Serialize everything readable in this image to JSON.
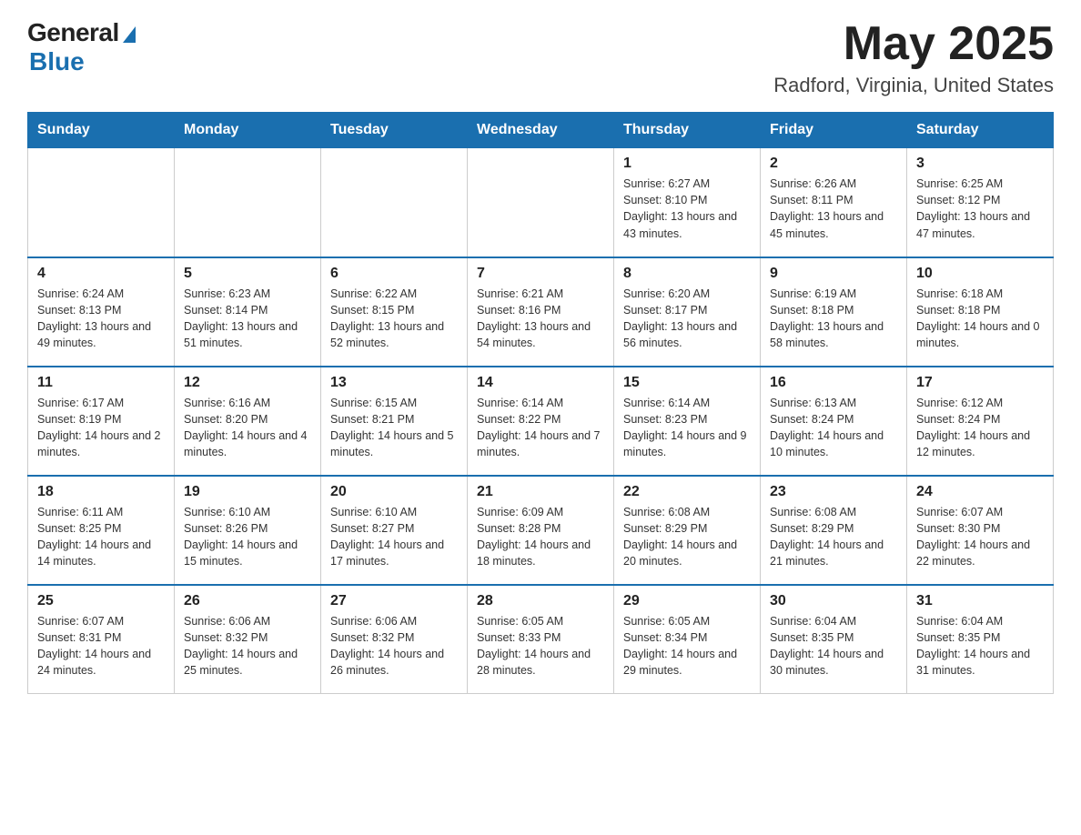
{
  "header": {
    "logo_general": "General",
    "logo_blue": "Blue",
    "month_title": "May 2025",
    "location": "Radford, Virginia, United States"
  },
  "days_of_week": [
    "Sunday",
    "Monday",
    "Tuesday",
    "Wednesday",
    "Thursday",
    "Friday",
    "Saturday"
  ],
  "weeks": [
    [
      {
        "day": "",
        "info": ""
      },
      {
        "day": "",
        "info": ""
      },
      {
        "day": "",
        "info": ""
      },
      {
        "day": "",
        "info": ""
      },
      {
        "day": "1",
        "info": "Sunrise: 6:27 AM\nSunset: 8:10 PM\nDaylight: 13 hours and 43 minutes."
      },
      {
        "day": "2",
        "info": "Sunrise: 6:26 AM\nSunset: 8:11 PM\nDaylight: 13 hours and 45 minutes."
      },
      {
        "day": "3",
        "info": "Sunrise: 6:25 AM\nSunset: 8:12 PM\nDaylight: 13 hours and 47 minutes."
      }
    ],
    [
      {
        "day": "4",
        "info": "Sunrise: 6:24 AM\nSunset: 8:13 PM\nDaylight: 13 hours and 49 minutes."
      },
      {
        "day": "5",
        "info": "Sunrise: 6:23 AM\nSunset: 8:14 PM\nDaylight: 13 hours and 51 minutes."
      },
      {
        "day": "6",
        "info": "Sunrise: 6:22 AM\nSunset: 8:15 PM\nDaylight: 13 hours and 52 minutes."
      },
      {
        "day": "7",
        "info": "Sunrise: 6:21 AM\nSunset: 8:16 PM\nDaylight: 13 hours and 54 minutes."
      },
      {
        "day": "8",
        "info": "Sunrise: 6:20 AM\nSunset: 8:17 PM\nDaylight: 13 hours and 56 minutes."
      },
      {
        "day": "9",
        "info": "Sunrise: 6:19 AM\nSunset: 8:18 PM\nDaylight: 13 hours and 58 minutes."
      },
      {
        "day": "10",
        "info": "Sunrise: 6:18 AM\nSunset: 8:18 PM\nDaylight: 14 hours and 0 minutes."
      }
    ],
    [
      {
        "day": "11",
        "info": "Sunrise: 6:17 AM\nSunset: 8:19 PM\nDaylight: 14 hours and 2 minutes."
      },
      {
        "day": "12",
        "info": "Sunrise: 6:16 AM\nSunset: 8:20 PM\nDaylight: 14 hours and 4 minutes."
      },
      {
        "day": "13",
        "info": "Sunrise: 6:15 AM\nSunset: 8:21 PM\nDaylight: 14 hours and 5 minutes."
      },
      {
        "day": "14",
        "info": "Sunrise: 6:14 AM\nSunset: 8:22 PM\nDaylight: 14 hours and 7 minutes."
      },
      {
        "day": "15",
        "info": "Sunrise: 6:14 AM\nSunset: 8:23 PM\nDaylight: 14 hours and 9 minutes."
      },
      {
        "day": "16",
        "info": "Sunrise: 6:13 AM\nSunset: 8:24 PM\nDaylight: 14 hours and 10 minutes."
      },
      {
        "day": "17",
        "info": "Sunrise: 6:12 AM\nSunset: 8:24 PM\nDaylight: 14 hours and 12 minutes."
      }
    ],
    [
      {
        "day": "18",
        "info": "Sunrise: 6:11 AM\nSunset: 8:25 PM\nDaylight: 14 hours and 14 minutes."
      },
      {
        "day": "19",
        "info": "Sunrise: 6:10 AM\nSunset: 8:26 PM\nDaylight: 14 hours and 15 minutes."
      },
      {
        "day": "20",
        "info": "Sunrise: 6:10 AM\nSunset: 8:27 PM\nDaylight: 14 hours and 17 minutes."
      },
      {
        "day": "21",
        "info": "Sunrise: 6:09 AM\nSunset: 8:28 PM\nDaylight: 14 hours and 18 minutes."
      },
      {
        "day": "22",
        "info": "Sunrise: 6:08 AM\nSunset: 8:29 PM\nDaylight: 14 hours and 20 minutes."
      },
      {
        "day": "23",
        "info": "Sunrise: 6:08 AM\nSunset: 8:29 PM\nDaylight: 14 hours and 21 minutes."
      },
      {
        "day": "24",
        "info": "Sunrise: 6:07 AM\nSunset: 8:30 PM\nDaylight: 14 hours and 22 minutes."
      }
    ],
    [
      {
        "day": "25",
        "info": "Sunrise: 6:07 AM\nSunset: 8:31 PM\nDaylight: 14 hours and 24 minutes."
      },
      {
        "day": "26",
        "info": "Sunrise: 6:06 AM\nSunset: 8:32 PM\nDaylight: 14 hours and 25 minutes."
      },
      {
        "day": "27",
        "info": "Sunrise: 6:06 AM\nSunset: 8:32 PM\nDaylight: 14 hours and 26 minutes."
      },
      {
        "day": "28",
        "info": "Sunrise: 6:05 AM\nSunset: 8:33 PM\nDaylight: 14 hours and 28 minutes."
      },
      {
        "day": "29",
        "info": "Sunrise: 6:05 AM\nSunset: 8:34 PM\nDaylight: 14 hours and 29 minutes."
      },
      {
        "day": "30",
        "info": "Sunrise: 6:04 AM\nSunset: 8:35 PM\nDaylight: 14 hours and 30 minutes."
      },
      {
        "day": "31",
        "info": "Sunrise: 6:04 AM\nSunset: 8:35 PM\nDaylight: 14 hours and 31 minutes."
      }
    ]
  ]
}
